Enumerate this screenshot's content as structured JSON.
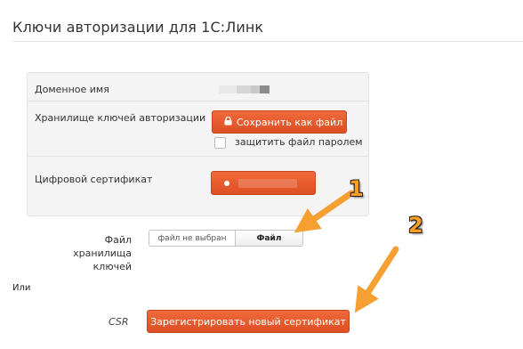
{
  "page_title": "Ключи авторизации для 1С:Линк",
  "domain_row": {
    "label": "Доменное имя"
  },
  "key_storage_row": {
    "label": "Хранилище ключей авторизации",
    "save_button": {
      "label": "Сохранить как файл",
      "icon": "lock-icon"
    },
    "protect_option": {
      "label": "защитить файл паролем",
      "checked": false
    }
  },
  "certificate_row": {
    "label": "Цифровой сертификат"
  },
  "key_file_row": {
    "label_line1": "Файл хранилища",
    "label_line2": "ключей",
    "file_status": "файл не выбран",
    "file_button_label": "Файл"
  },
  "or_label": "Или",
  "csr_row": {
    "label": "CSR",
    "register_button_label": "Зарегистрировать новый сертификат"
  },
  "annotations": {
    "marker_1": "1",
    "marker_2": "2"
  },
  "colors": {
    "accent_orange": "#e55a2b",
    "annotation_orange": "#ffa024"
  }
}
